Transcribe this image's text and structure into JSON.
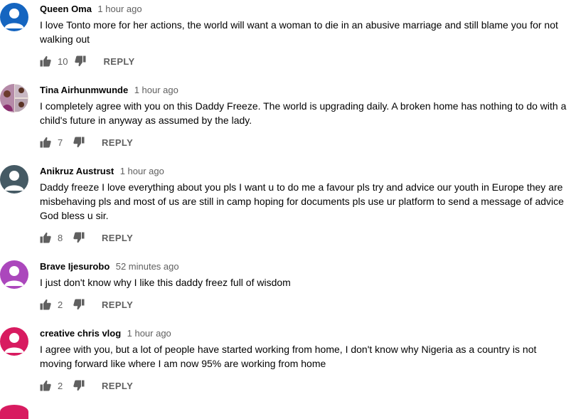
{
  "comments": [
    {
      "author": "Queen Oma",
      "time": "1 hour ago",
      "text": "I love Tonto more for her actions, the world will want a woman to die in an abusive marriage and still blame you for not walking out",
      "likes": "10",
      "reply_label": "REPLY",
      "avatar_color": "#1565c0"
    },
    {
      "author": "Tina Airhunmwunde",
      "time": "1 hour ago",
      "text": "I completely agree with you on this Daddy Freeze. The world is upgrading daily. A broken home has nothing to do with a child's future in anyway as assumed by the lady.",
      "likes": "7",
      "reply_label": "REPLY",
      "avatar_color": "#8d5a7a"
    },
    {
      "author": "Anikruz Austrust",
      "time": "1 hour ago",
      "text": "Daddy freeze I love everything about you pls I want u to do me a favour pls try and advice our youth in Europe they are misbehaving pls and most of us are still in camp hoping for documents pls use ur platform to send a message of advice God bless u sir.",
      "likes": "8",
      "reply_label": "REPLY",
      "avatar_color": "#455a64"
    },
    {
      "author": "Brave Ijesurobo",
      "time": "52 minutes ago",
      "text": "I just don't know why I like this daddy freez full of wisdom",
      "likes": "2",
      "reply_label": "REPLY",
      "avatar_color": "#ab47bc"
    },
    {
      "author": "creative chris vlog",
      "time": "1 hour ago",
      "text": "I agree with you, but a lot of people have started working from home, I don't know why Nigeria as a country is not moving forward like where I am now 95% are working from home",
      "likes": "2",
      "reply_label": "REPLY",
      "avatar_color": "#d81b60"
    }
  ]
}
